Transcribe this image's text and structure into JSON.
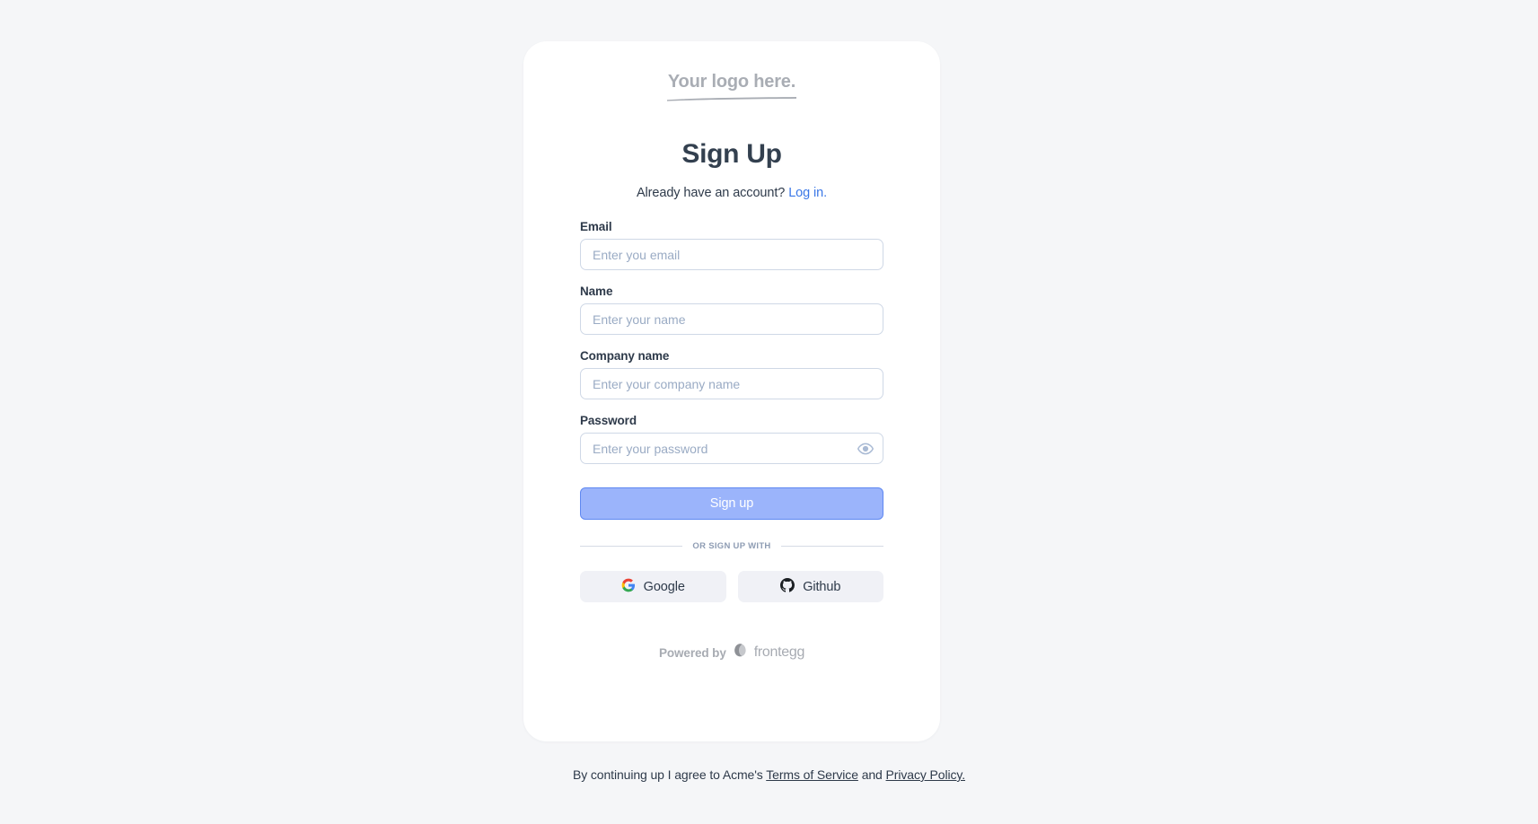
{
  "brand": {
    "logo_text": "Your logo here.",
    "logo_color": "#a9adb4"
  },
  "header": {
    "title": "Sign Up",
    "subtitle_prefix": "Already have an account?",
    "login_link_label": "Log in.",
    "link_color": "#3b78e7"
  },
  "form": {
    "fields": [
      {
        "label": "Email",
        "placeholder": "Enter you email",
        "value": "",
        "type": "email"
      },
      {
        "label": "Name",
        "placeholder": "Enter your name",
        "value": "",
        "type": "text"
      },
      {
        "label": "Company name",
        "placeholder": "Enter your company name",
        "value": "",
        "type": "text"
      },
      {
        "label": "Password",
        "placeholder": "Enter your password",
        "value": "",
        "type": "password",
        "icon": "eye-icon"
      }
    ],
    "submit_label": "Sign up",
    "submit_color": "#9bb4fb",
    "submit_border_color": "#5f88f1"
  },
  "divider": {
    "text": "OR SIGN UP WITH"
  },
  "social": {
    "buttons": [
      {
        "label": "Google",
        "icon": "google-icon"
      },
      {
        "label": "Github",
        "icon": "github-icon"
      }
    ],
    "background": "#f0f1f6"
  },
  "footer": {
    "powered_by": "Powered by",
    "brand_name": "frontegg"
  },
  "legal": {
    "prefix": "By continuing up I agree to Acme's",
    "terms_label": "Terms of Service",
    "conjunction": "and",
    "privacy_label": "Privacy Policy."
  }
}
